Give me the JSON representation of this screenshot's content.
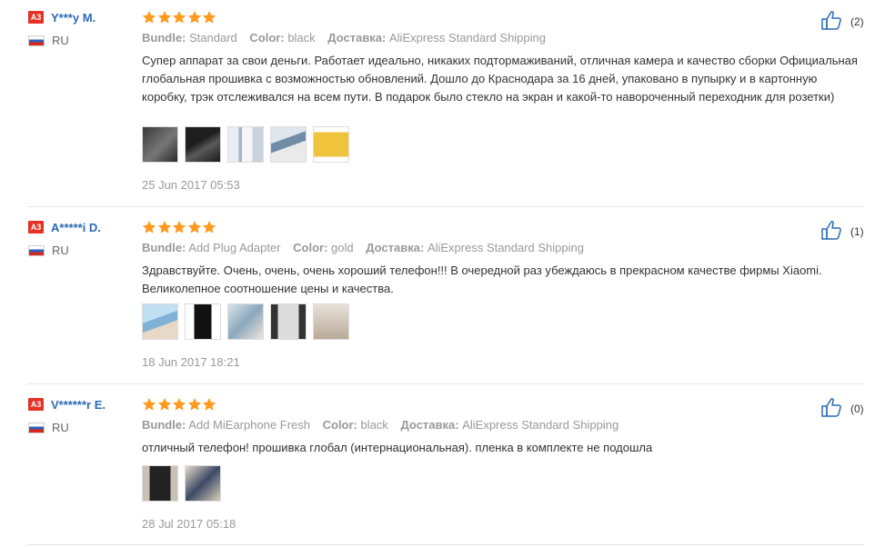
{
  "colors": {
    "accent": "#2a6bb3",
    "badge": "#e43225",
    "stars": "#ff9a1e"
  },
  "labels": {
    "bundle": "Bundle:",
    "color": "Color:",
    "delivery": "Доставка:"
  },
  "reviews": [
    {
      "badge": "A3",
      "name": "Y***y M.",
      "country": "RU",
      "stars": 5,
      "bundle": "Standard",
      "color": "black",
      "delivery": "AliExpress Standard Shipping",
      "text": "Супер аппарат за свои деньги. Работает идеально, никаких подтормаживаний, отличная камера и качество сборки Официальная глобальная прошивка с возможностью обновлений. Дошло до Краснодара за 16 дней, упаковано в пупырку и в картонную коробку, трэк отслеживался на всем пути. В подарок было стекло на экран и какой-то навороченный переходник для розетки)",
      "photos": 5,
      "date": "25 Jun 2017 05:53",
      "likes": "(2)"
    },
    {
      "badge": "A3",
      "name": "A*****i D.",
      "country": "RU",
      "stars": 5,
      "bundle": "Add Plug Adapter",
      "color": "gold",
      "delivery": "AliExpress Standard Shipping",
      "text": "Здравствуйте. Очень, очень, очень хороший телефон!!! В очередной раз убеждаюсь в прекрасном качестве фирмы Xiaomi. Великолепное соотношение цены и качества.",
      "photos": 5,
      "date": "18 Jun 2017 18:21",
      "likes": "(1)"
    },
    {
      "badge": "A3",
      "name": "V******r E.",
      "country": "RU",
      "stars": 5,
      "bundle": "Add MiEarphone Fresh",
      "color": "black",
      "delivery": "AliExpress Standard Shipping",
      "text": "отличный телефон! прошивка глобал (интернациональная). пленка в комплекте не подошла",
      "photos": 2,
      "date": "28 Jul 2017 05:18",
      "likes": "(0)"
    }
  ]
}
